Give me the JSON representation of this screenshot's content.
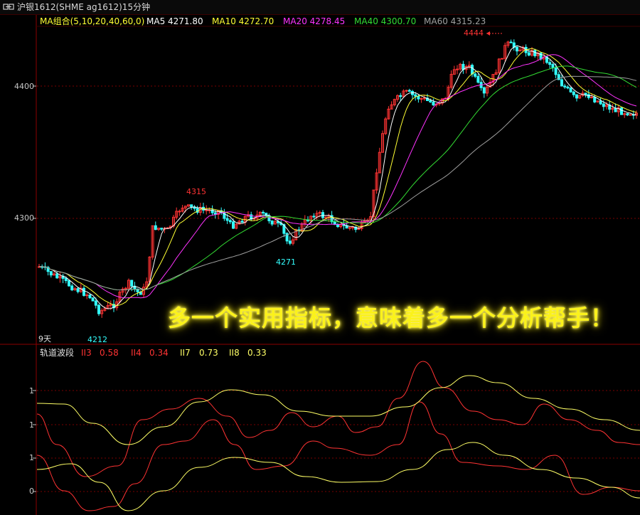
{
  "header": {
    "title": "沪银1612(SHME  ag1612)15分钟",
    "ma_group": "MA组合(5,10,20,40,60,0)",
    "ma": [
      {
        "label": "MA5 4271.80",
        "color": "#ffffff"
      },
      {
        "label": "MA10 4272.70",
        "color": "#ffff33"
      },
      {
        "label": "MA20 4278.45",
        "color": "#ff33ff"
      },
      {
        "label": "MA40 4300.70",
        "color": "#33dd33"
      },
      {
        "label": "MA60 4315.23",
        "color": "#a0a0a0"
      }
    ]
  },
  "price_axis": {
    "upper": "4400",
    "lower": "4300"
  },
  "annotations": {
    "high": "4444",
    "local_high": "4315",
    "local_low": "4271",
    "low": "4212",
    "days": "9天"
  },
  "overlay_text": "多一个实用指标，意味着多一个分析帮手！",
  "indicator": {
    "name": "轨道波段",
    "series": [
      {
        "label": "II3",
        "value": "0.58",
        "color": "#ff3333"
      },
      {
        "label": "II4",
        "value": "0.34",
        "color": "#ff3333"
      },
      {
        "label": "II7",
        "value": "0.73",
        "color": "#ffff66"
      },
      {
        "label": "II8",
        "value": "0.33",
        "color": "#ffff66"
      }
    ],
    "axis_labels": [
      "1",
      "1",
      "1",
      "0"
    ]
  },
  "colors": {
    "up": "#ff3333",
    "down": "#33ffff",
    "grid": "#7a0000",
    "border": "#8b0000"
  }
}
